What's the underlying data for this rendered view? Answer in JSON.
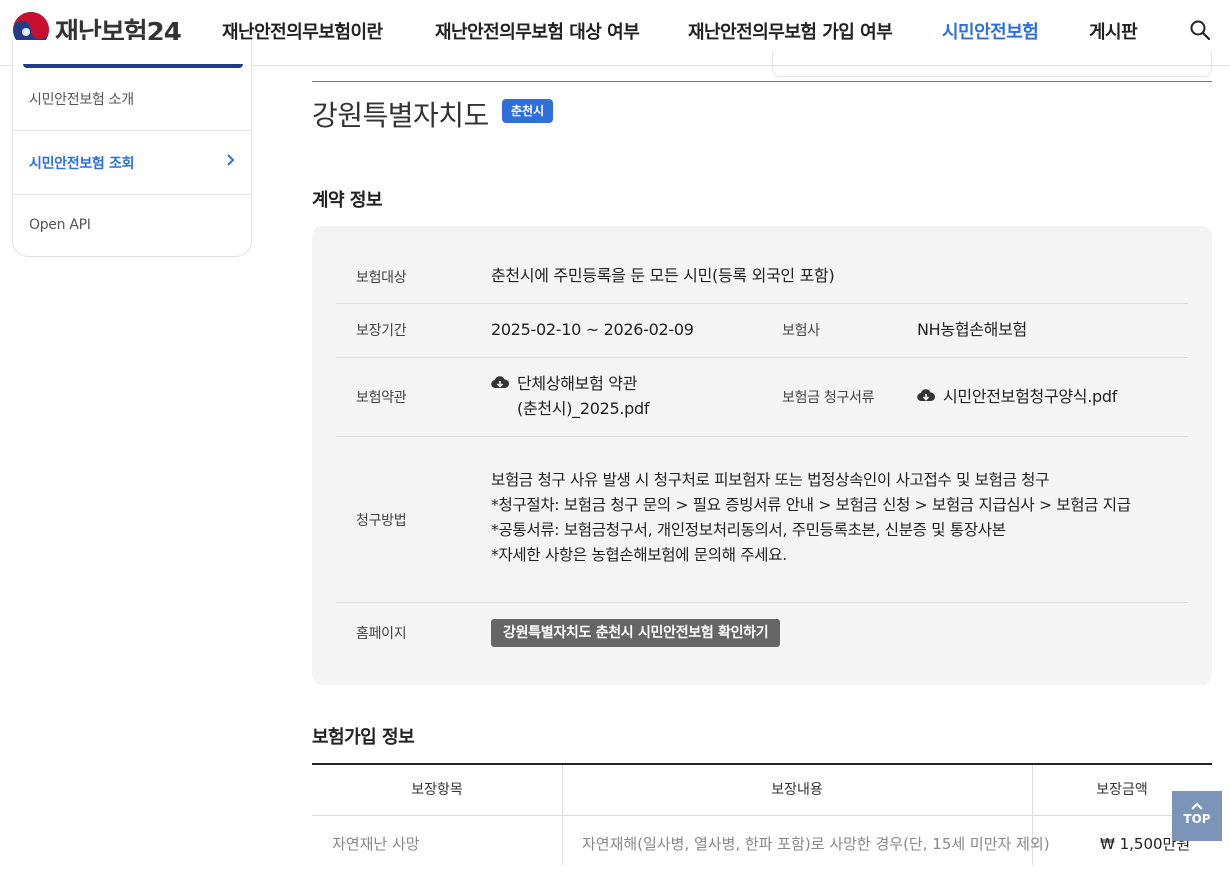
{
  "header": {
    "logo_text": "재난보험24",
    "nav": [
      {
        "label": "재난안전의무보험이란",
        "active": false
      },
      {
        "label": "재난안전의무보험 대상 여부",
        "active": false
      },
      {
        "label": "재난안전의무보험 가입 여부",
        "active": false
      },
      {
        "label": "시민안전보험",
        "active": true
      },
      {
        "label": "게시판",
        "active": false
      }
    ],
    "search_icon": "search-icon"
  },
  "sidebar": {
    "items": [
      {
        "label": "시민안전보험 소개",
        "active": false
      },
      {
        "label": "시민안전보험 조회",
        "active": true
      },
      {
        "label": "Open API",
        "active": false
      }
    ]
  },
  "region": {
    "title": "강원특별자치도",
    "badge": "춘천시"
  },
  "contract": {
    "section_title": "계약 정보",
    "target_label": "보험대상",
    "target_value": "춘천시에 주민등록을 둔 모든 시민(등록 외국인 포함)",
    "period_label": "보장기간",
    "period_value": "2025-02-10 ~ 2026-02-09",
    "insurer_label": "보험사",
    "insurer_value": "NH농협손해보험",
    "terms_label": "보험약관",
    "terms_file_line1": "단체상해보험 약관",
    "terms_file_line2": "(춘천시)_2025.pdf",
    "claim_docs_label": "보험금 청구서류",
    "claim_docs_file": "시민안전보험청구양식.pdf",
    "claim_label": "청구방법",
    "claim_lines": [
      "보험금 청구 사유 발생 시 청구처로 피보험자 또는 법정상속인이 사고접수 및 보험금 청구",
      "*청구절차: 보험금 청구 문의 > 필요 증빙서류 안내 > 보험금 신청 > 보험금 지급심사 > 보험금 지급",
      "*공통서류: 보험금청구서, 개인정보처리동의서, 주민등록초본, 신분증 및 통장사본",
      "*자세한 사항은 농협손해보험에 문의해 주세요."
    ],
    "homepage_label": "홈페이지",
    "homepage_button": "강원특별자치도 춘천시 시민안전보험 확인하기"
  },
  "enrollment": {
    "section_title": "보험가입 정보",
    "columns": [
      "보장항목",
      "보장내용",
      "보장금액"
    ],
    "rows": [
      {
        "item": "자연재난 사망",
        "content": "자연재해(일사병, 열사병, 한파 포함)로 사망한 경우(단, 15세 미만자 제외)",
        "amount": "₩  1,500만원"
      }
    ]
  },
  "top_button": "TOP"
}
